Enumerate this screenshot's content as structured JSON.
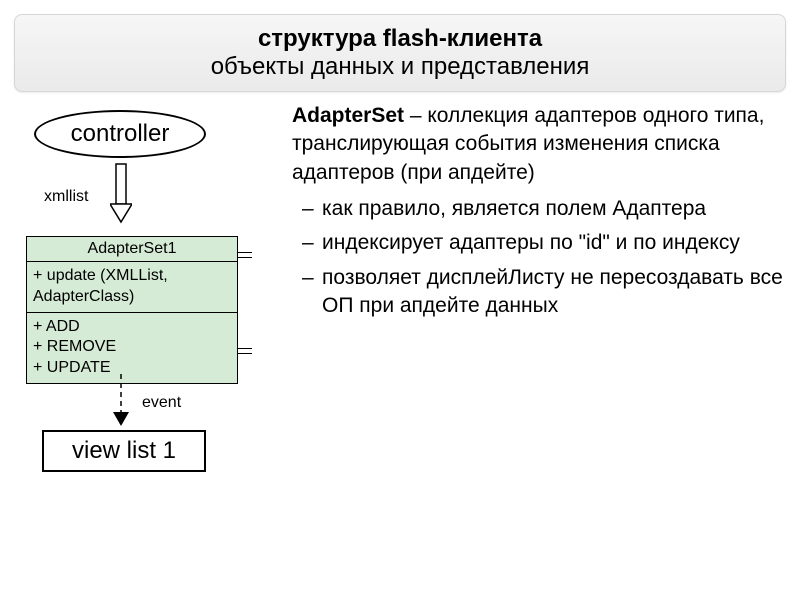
{
  "title": {
    "line1": "структура flash-клиента",
    "line2": "объекты данных и представления"
  },
  "diagram": {
    "controller": "controller",
    "xmllist_label": "xmllist",
    "uml": {
      "name": "AdapterSet1",
      "operation": "+ update (XMLList, AdapterClass)",
      "events": [
        "+ ADD",
        "+ REMOVE",
        "+ UPDATE"
      ]
    },
    "event_label": "event",
    "view_label": "view list 1"
  },
  "text": {
    "lead_bold": "AdapterSet",
    "lead_rest": " – коллекция адаптеров одного типа, транслирующая события изменения списка адаптеров (при апдейте)",
    "bullets": [
      "как правило, является полем Адаптера",
      "индексирует адаптеры по \"id\" и по индексу",
      "позволяет дисплейЛисту не пересоздавать все ОП при апдейте данных"
    ]
  }
}
